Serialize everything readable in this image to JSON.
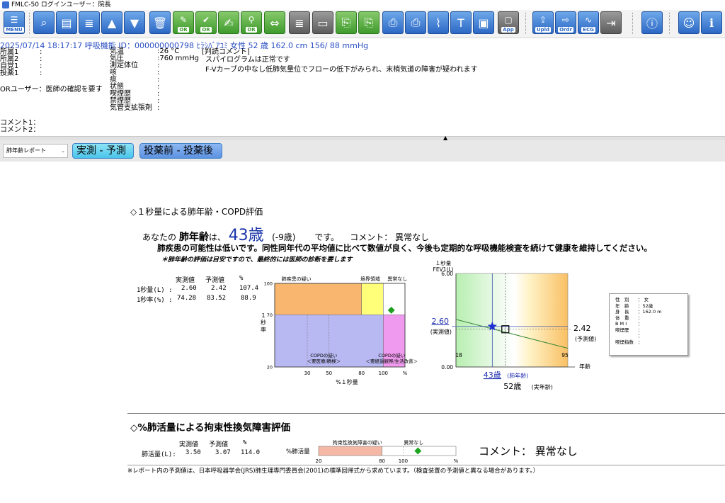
{
  "window": {
    "title": "FMLC-50  ログインユーザー：院長"
  },
  "toolbar": {
    "buttons": [
      {
        "name": "menu-button",
        "icon": "menu-icon",
        "label": "MENU",
        "color": "blue"
      },
      {
        "name": "search-button",
        "icon": "search-icon",
        "label": "",
        "color": "blue"
      },
      {
        "name": "card-button",
        "icon": "card-icon",
        "label": "",
        "color": "blue"
      },
      {
        "name": "list-button",
        "icon": "list-icon",
        "label": "",
        "color": "blue"
      },
      {
        "name": "up-button",
        "icon": "arrow-up-icon",
        "label": "",
        "color": "blue"
      },
      {
        "name": "down-button",
        "icon": "arrow-down-icon",
        "label": "",
        "color": "blue"
      },
      {
        "name": "delete-button",
        "icon": "trash-icon",
        "label": "",
        "color": "blue"
      },
      {
        "name": "edit-or-button",
        "icon": "pen-icon",
        "label": "OR",
        "color": "green"
      },
      {
        "name": "check-or-button",
        "icon": "check-icon",
        "label": "OR",
        "color": "green"
      },
      {
        "name": "memo-button",
        "icon": "memo-icon",
        "label": "",
        "color": "green"
      },
      {
        "name": "stamp-or-button",
        "icon": "stamp-icon",
        "label": "OR",
        "color": "green"
      },
      {
        "name": "compare-button",
        "icon": "compare-icon",
        "label": "",
        "color": "green"
      },
      {
        "name": "list2-button",
        "icon": "list-icon",
        "label": "",
        "color": "gray"
      },
      {
        "name": "ruler-button",
        "icon": "ruler-icon",
        "label": "",
        "color": "gray"
      },
      {
        "name": "doc-button",
        "icon": "document-icon",
        "label": "",
        "color": "green"
      },
      {
        "name": "doc-plus-button",
        "icon": "document-plus-icon",
        "label": "",
        "color": "green"
      },
      {
        "name": "print-button",
        "icon": "printer-icon",
        "label": "",
        "color": "blue"
      },
      {
        "name": "print2-button",
        "icon": "printer-icon",
        "label": "",
        "color": "blue"
      },
      {
        "name": "attach-button",
        "icon": "paperclip-icon",
        "label": "",
        "color": "blue"
      },
      {
        "name": "text-button",
        "icon": "text-icon",
        "label": "T",
        "color": "blue"
      },
      {
        "name": "display-button",
        "icon": "monitor-icon",
        "label": "",
        "color": "blue"
      },
      {
        "name": "app-button",
        "icon": "app-icon",
        "label": "App",
        "color": "gray"
      },
      {
        "name": "upload-button",
        "icon": "upload-icon",
        "label": "Upld",
        "color": "blue"
      },
      {
        "name": "order-button",
        "icon": "order-icon",
        "label": "Ordr",
        "color": "blue"
      },
      {
        "name": "ecg-button",
        "icon": "ecg-icon",
        "label": "ECG",
        "color": "blue"
      },
      {
        "name": "transfer-button",
        "icon": "transfer-icon",
        "label": "",
        "color": "gray"
      },
      {
        "name": "info-button",
        "icon": "info-icon",
        "label": "i",
        "color": "blue"
      },
      {
        "name": "user-button",
        "icon": "user-icon",
        "label": "",
        "color": "blue"
      },
      {
        "name": "help-button",
        "icon": "help-icon",
        "label": "i",
        "color": "blue"
      }
    ]
  },
  "header": {
    "patient_line": "2025/07/14 18:17:17   呼吸機能  ID：000000000798  ﾋﾗｼﾊﾞｱﾕﾐ  女性 52  歳 162.0 cm  156/ 88 mmHg",
    "left_labels": [
      "所属1",
      "所属2",
      "自覚1",
      "投薬1"
    ],
    "left_colons": [
      ":",
      ":",
      ":",
      ":"
    ],
    "or_user": "ORユーザー：医師の確認を要す",
    "mid_labels": [
      "気温",
      "気圧",
      "測定体位",
      "咳",
      "痰",
      "状態",
      "喫煙歴",
      "禁煙歴",
      "気管支拡張剤"
    ],
    "mid_values": [
      ":26 °C",
      ":760 mmHg",
      ":",
      ":",
      ":",
      ":",
      ":",
      ":",
      ":"
    ],
    "judgment_title": "[判読コメント]",
    "judgment_lines": [
      "スパイログラムは正常です",
      "F-Vカーブの中なし低肺気量位でフローの低下がみられ、末梢気道の障害が疑われます"
    ],
    "comment1": "コメント1：",
    "comment2": "コメント2："
  },
  "report_bar": {
    "select_value": "肺年齢レポート",
    "btn_actual_predicted": "実測 - 予測",
    "btn_before_after": "投薬前 - 投薬後"
  },
  "report": {
    "section1_title": "◇１秒量による肺年齢・COPD評価",
    "age_prefix": "あなたの",
    "age_label": "肺年齢",
    "age_particle": "は、",
    "lung_age": "43歳",
    "age_diff": "(-9歳)",
    "age_suffix": "です。",
    "comment_label": "コメント：",
    "comment_value": "異常なし",
    "main_message": "肺疾患の可能性は低いです。同性同年代の平均値に比べて数値が良く、今後も定期的な呼吸機能検査を続けて健康を維持してください。",
    "note": "＊肺年齢の評価は目安ですので、最終的には医師の診断を要します",
    "table1": {
      "headers": [
        "実測値",
        "予測値",
        "%"
      ],
      "rows": [
        {
          "label": "1秒量(L) :",
          "actual": "2.60",
          "predicted": "2.42",
          "pct": "107.4"
        },
        {
          "label": "1秒率(%) :",
          "actual": "74.28",
          "predicted": "83.52",
          "pct": "88.9"
        }
      ]
    },
    "section2_title": "◇%肺活量による拘束性換気障害評価",
    "table2": {
      "headers": [
        "実測値",
        "予測値",
        "%"
      ],
      "label": "肺活量(L):",
      "actual": "3.50",
      "predicted": "3.07",
      "pct": "114.0"
    },
    "vc_bar": {
      "label": "%肺活量",
      "zone_labels": [
        "拘束性換気障害の疑い",
        "異常なし"
      ],
      "ticks": [
        "20",
        "80",
        "100"
      ],
      "unit": "%",
      "value_pct": 114.0,
      "range": [
        20,
        150
      ]
    },
    "comment2_label": "コメント：",
    "comment2_value": "異常なし",
    "footnote": "※レポート内の予測値は、日本呼吸器学会(JRS)肺生理専門委員会(2001)の標準回帰式から求めています。（検査装置の予測値と異なる場合があります。）",
    "info_box": [
      {
        "k": "性　別",
        "v": "：  女"
      },
      {
        "k": "年　齢",
        "v": "：52歳"
      },
      {
        "k": "身　長",
        "v": "：162.0 m"
      },
      {
        "k": "体　重",
        "v": "："
      },
      {
        "k": "B M I",
        "v": "："
      },
      {
        "k": "喫煙歴",
        "v": "："
      },
      {
        "k": "",
        "v": "："
      },
      {
        "k": "喫煙指数",
        "v": "："
      }
    ]
  },
  "chart_data": [
    {
      "type": "scatter",
      "title": "",
      "xlabel": "%１秒量",
      "ylabel": "１秒率",
      "xlim": [
        0,
        120
      ],
      "ylim": [
        20,
        100
      ],
      "x_ticks": [
        "30",
        "50",
        "80",
        "100"
      ],
      "x_unit": "%",
      "y_ticks": [
        "100",
        "70",
        "20"
      ],
      "zones": [
        {
          "label": "肺疾患の疑い",
          "color": "#f9b66f"
        },
        {
          "label": "境界領域",
          "color": "#ffff7a"
        },
        {
          "label": "異常なし",
          "color": "#ffffff"
        },
        {
          "label": "COPDの疑い\n＜要医療/精検＞",
          "color": "#b8b8f2"
        },
        {
          "label": "COPDの疑い\n＜要経過観察/生活改善＞",
          "color": "#ef9aee"
        }
      ],
      "point": {
        "x": 107.4,
        "y": 74.28,
        "color": "#1e9e1e",
        "marker": "diamond"
      }
    },
    {
      "type": "line",
      "title": "",
      "ylabel_lines": [
        "１秒量",
        "FEV1(L)"
      ],
      "xlabel": "年齢",
      "ylim": [
        0,
        6
      ],
      "xlim": [
        18,
        95
      ],
      "y_ticks": [
        "6.00",
        "0.00"
      ],
      "x_ticks": [
        "18",
        "95"
      ],
      "series": [
        {
          "x": [
            18,
            95
          ],
          "y": [
            3.05,
            1.2
          ],
          "color": "#3a8a3a"
        }
      ],
      "actual": {
        "x": 43,
        "y": 2.6,
        "label": "2.60",
        "sub": "(実測値)"
      },
      "predicted": {
        "x": 52,
        "y": 2.42,
        "label": "2.42",
        "sub": "(予測値)"
      },
      "lung_age_label": "43歳",
      "lung_age_sub": "(肺年齢)",
      "real_age_label": "52歳",
      "real_age_sub": "(実年齢)"
    }
  ]
}
